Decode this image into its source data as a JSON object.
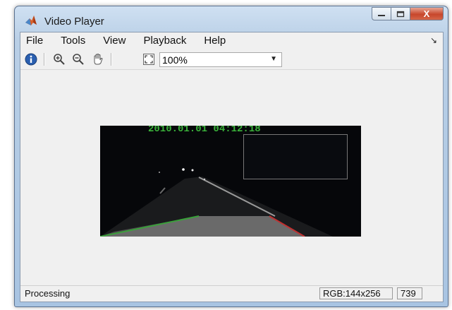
{
  "window": {
    "title": "Video Player",
    "close_glyph": "X"
  },
  "menu": {
    "items": [
      "File",
      "Tools",
      "View",
      "Playback",
      "Help"
    ],
    "dock_arrow": "↘"
  },
  "toolbar": {
    "icons": [
      "info-icon",
      "zoom-in-icon",
      "zoom-out-icon",
      "pan-hand-icon",
      "fit-to-window-icon"
    ],
    "zoom_value": "100%"
  },
  "video": {
    "timestamp": "2010.01.01 04:12:18"
  },
  "status": {
    "text": "Processing",
    "image_info": "RGB:144x256",
    "frame_number": "739"
  },
  "colors": {
    "accent_green": "#3ab23a",
    "lane_red": "#c03030",
    "window_frame": "#b9cfe6"
  }
}
